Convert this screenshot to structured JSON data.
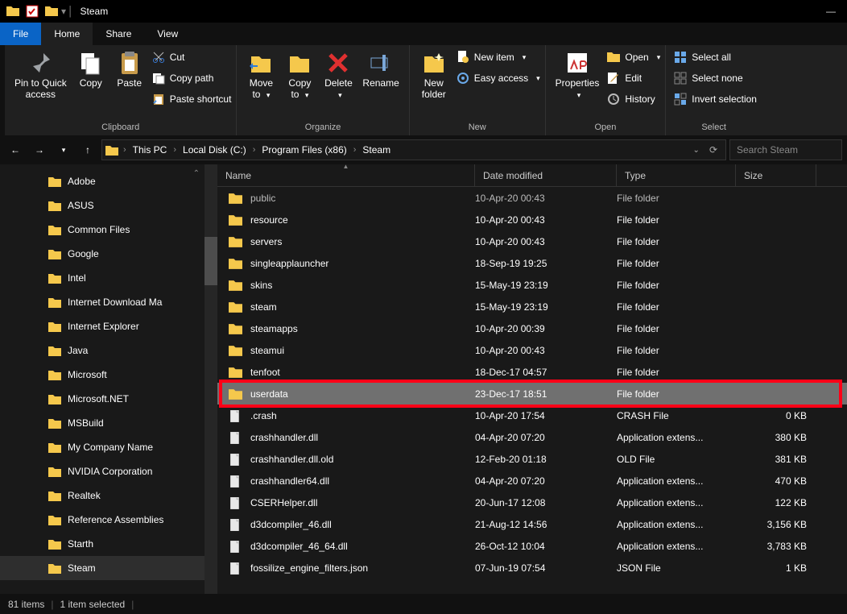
{
  "window": {
    "title": "Steam"
  },
  "menu": {
    "file": "File",
    "home": "Home",
    "share": "Share",
    "view": "View"
  },
  "ribbon": {
    "clipboard": {
      "label": "Clipboard",
      "pin": "Pin to Quick\naccess",
      "copy": "Copy",
      "paste": "Paste",
      "cut": "Cut",
      "copy_path": "Copy path",
      "paste_shortcut": "Paste shortcut"
    },
    "organize": {
      "label": "Organize",
      "move": "Move\nto",
      "copy_to": "Copy\nto",
      "delete": "Delete",
      "rename": "Rename"
    },
    "new": {
      "label": "New",
      "new_folder": "New\nfolder",
      "new_item": "New item",
      "easy_access": "Easy access"
    },
    "open": {
      "label": "Open",
      "properties": "Properties",
      "open": "Open",
      "edit": "Edit",
      "history": "History"
    },
    "select": {
      "label": "Select",
      "select_all": "Select all",
      "select_none": "Select none",
      "invert": "Invert selection"
    }
  },
  "breadcrumb": {
    "this_pc": "This PC",
    "drive": "Local Disk (C:)",
    "pf": "Program Files (x86)",
    "steam": "Steam"
  },
  "search": {
    "placeholder": "Search Steam"
  },
  "tree": {
    "items": [
      "Adobe",
      "ASUS",
      "Common Files",
      "Google",
      "Intel",
      "Internet Download Ma",
      "Internet Explorer",
      "Java",
      "Microsoft",
      "Microsoft.NET",
      "MSBuild",
      "My Company Name",
      "NVIDIA Corporation",
      "Realtek",
      "Reference Assemblies",
      "Starth",
      "Steam"
    ]
  },
  "columns": {
    "name": "Name",
    "date": "Date modified",
    "type": "Type",
    "size": "Size"
  },
  "files": [
    {
      "name": "public",
      "date": "10-Apr-20 00:43",
      "type": "File folder",
      "size": "",
      "icon": "folder",
      "dim": true
    },
    {
      "name": "resource",
      "date": "10-Apr-20 00:43",
      "type": "File folder",
      "size": "",
      "icon": "folder"
    },
    {
      "name": "servers",
      "date": "10-Apr-20 00:43",
      "type": "File folder",
      "size": "",
      "icon": "folder"
    },
    {
      "name": "singleapplauncher",
      "date": "18-Sep-19 19:25",
      "type": "File folder",
      "size": "",
      "icon": "folder"
    },
    {
      "name": "skins",
      "date": "15-May-19 23:19",
      "type": "File folder",
      "size": "",
      "icon": "folder"
    },
    {
      "name": "steam",
      "date": "15-May-19 23:19",
      "type": "File folder",
      "size": "",
      "icon": "folder"
    },
    {
      "name": "steamapps",
      "date": "10-Apr-20 00:39",
      "type": "File folder",
      "size": "",
      "icon": "folder"
    },
    {
      "name": "steamui",
      "date": "10-Apr-20 00:43",
      "type": "File folder",
      "size": "",
      "icon": "folder"
    },
    {
      "name": "tenfoot",
      "date": "18-Dec-17 04:57",
      "type": "File folder",
      "size": "",
      "icon": "folder"
    },
    {
      "name": "userdata",
      "date": "23-Dec-17 18:51",
      "type": "File folder",
      "size": "",
      "icon": "folder",
      "selected": true
    },
    {
      "name": ".crash",
      "date": "10-Apr-20 17:54",
      "type": "CRASH File",
      "size": "0 KB",
      "icon": "file"
    },
    {
      "name": "crashhandler.dll",
      "date": "04-Apr-20 07:20",
      "type": "Application extens...",
      "size": "380 KB",
      "icon": "file"
    },
    {
      "name": "crashhandler.dll.old",
      "date": "12-Feb-20 01:18",
      "type": "OLD File",
      "size": "381 KB",
      "icon": "file"
    },
    {
      "name": "crashhandler64.dll",
      "date": "04-Apr-20 07:20",
      "type": "Application extens...",
      "size": "470 KB",
      "icon": "file"
    },
    {
      "name": "CSERHelper.dll",
      "date": "20-Jun-17 12:08",
      "type": "Application extens...",
      "size": "122 KB",
      "icon": "file"
    },
    {
      "name": "d3dcompiler_46.dll",
      "date": "21-Aug-12 14:56",
      "type": "Application extens...",
      "size": "3,156 KB",
      "icon": "file"
    },
    {
      "name": "d3dcompiler_46_64.dll",
      "date": "26-Oct-12 10:04",
      "type": "Application extens...",
      "size": "3,783 KB",
      "icon": "file"
    },
    {
      "name": "fossilize_engine_filters.json",
      "date": "07-Jun-19 07:54",
      "type": "JSON File",
      "size": "1 KB",
      "icon": "file"
    }
  ],
  "status": {
    "items": "81 items",
    "selected": "1 item selected"
  },
  "highlight_row_index": 9
}
